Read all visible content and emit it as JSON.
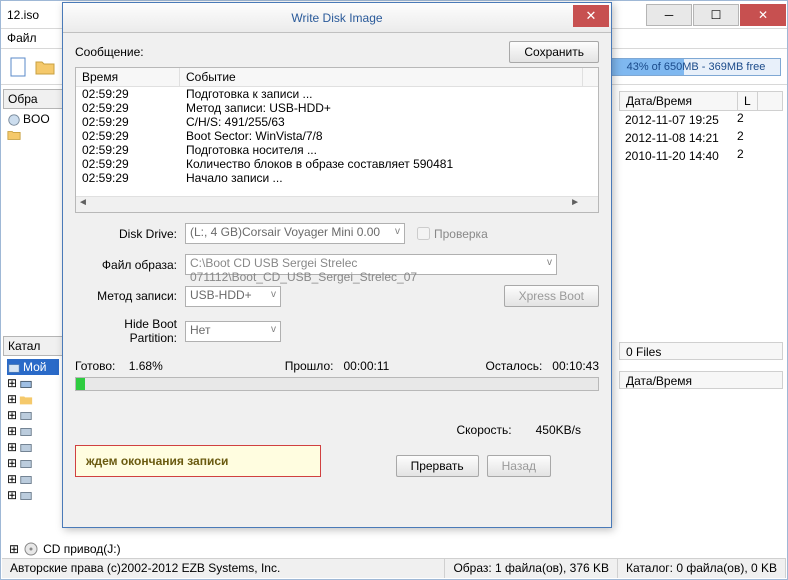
{
  "main": {
    "title_suffix": "12.iso",
    "menu": {
      "file": "Файл"
    },
    "disk_usage": "43% of 650MB - 369MB free",
    "side_tabs": {
      "obr": "Обра",
      "katal": "Катал",
      "moi": "Мой"
    },
    "tree_boot": "BOO",
    "right": {
      "header_date": "Дата/Время",
      "rows": [
        "2012-11-07 19:25",
        "2012-11-08 14:21",
        "2010-11-20 14:40"
      ],
      "files_suffix": "0 Files",
      "date2": "Дата/Время"
    },
    "cd_drive": "CD привод(J:)",
    "status": {
      "copy": "Авторские права (c)2002-2012 EZB Systems, Inc.",
      "img": "Образ: 1 файла(ов), 376 KB",
      "cat": "Каталог: 0 файла(ов), 0 KB"
    }
  },
  "dialog": {
    "title": "Write Disk Image",
    "msg_label": "Сообщение:",
    "save_btn": "Сохранить",
    "log": {
      "h_time": "Время",
      "h_event": "Событие",
      "rows": [
        {
          "t": "02:59:29",
          "e": "Подготовка к записи ..."
        },
        {
          "t": "02:59:29",
          "e": "Метод записи: USB-HDD+"
        },
        {
          "t": "02:59:29",
          "e": "C/H/S: 491/255/63"
        },
        {
          "t": "02:59:29",
          "e": "Boot Sector: WinVista/7/8"
        },
        {
          "t": "02:59:29",
          "e": "Подготовка носителя ..."
        },
        {
          "t": "02:59:29",
          "e": "Количество блоков в образе составляет 590481"
        },
        {
          "t": "02:59:29",
          "e": "Начало записи ..."
        }
      ]
    },
    "form": {
      "disk_drive_lbl": "Disk Drive:",
      "disk_drive_val": "(L:, 4 GB)Corsair Voyager Mini   0.00",
      "check_lbl": "Проверка",
      "file_lbl": "Файл образа:",
      "file_val": "C:\\Boot CD USB Sergei Strelec 071112\\Boot_CD_USB_Sergei_Strelec_07",
      "method_lbl": "Метод записи:",
      "method_val": "USB-HDD+",
      "xpress": "Xpress Boot",
      "hide_lbl": "Hide Boot Partition:",
      "hide_val": "Нет"
    },
    "progress": {
      "done_lbl": "Готово:",
      "done_val": "1.68%",
      "elapsed_lbl": "Прошло:",
      "elapsed_val": "00:00:11",
      "remain_lbl": "Осталось:",
      "remain_val": "00:10:43",
      "speed_lbl": "Скорость:",
      "speed_val": "450KB/s"
    },
    "note": "ждем окончания записи",
    "abort": "Прервать",
    "back": "Назад"
  }
}
